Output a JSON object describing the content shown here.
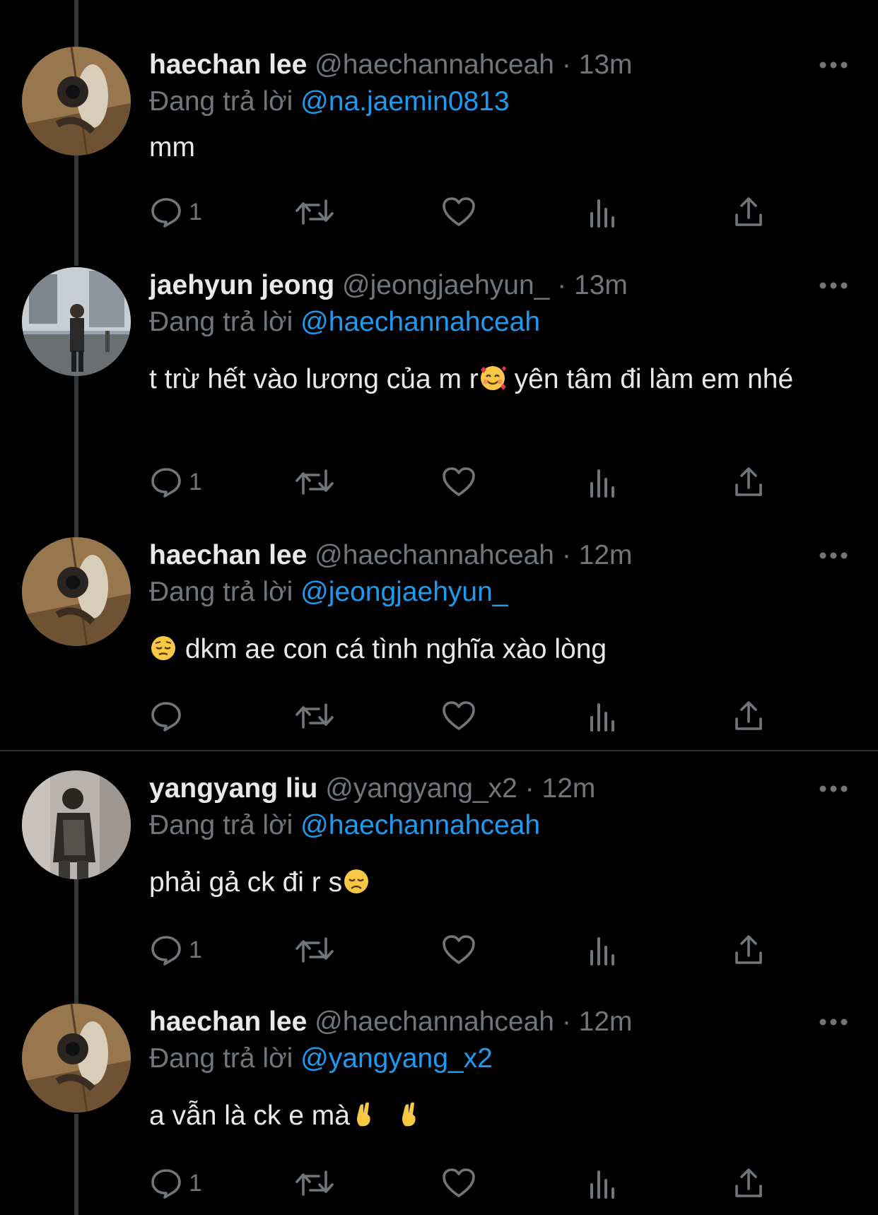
{
  "reply_prefix": "Đang trả lời",
  "colors": {
    "background": "#000000",
    "text": "#e7e9ea",
    "muted": "#71767b",
    "mention": "#1d9bf0",
    "thread_line": "#333639"
  },
  "tweets": [
    {
      "name": "haechan lee",
      "handle": "@haechannahceah",
      "time": "· 13m",
      "reply_to": "@na.jaemin0813",
      "text": "mm",
      "reply_count": "1"
    },
    {
      "name": "jaehyun jeong",
      "handle": "@jeongjaehyun_",
      "time": "· 13m",
      "reply_to": "@haechannahceah",
      "text_a": "t trừ hết vào lương của m r",
      "text_b": " yên tâm đi làm em nhé",
      "emoji": "smiling-face-with-hearts",
      "reply_count": "1"
    },
    {
      "name": "haechan lee",
      "handle": "@haechannahceah",
      "time": "· 12m",
      "reply_to": "@jeongjaehyun_",
      "text": " dkm ae con cá tình nghĩa xào lòng",
      "emoji": "pensive-face",
      "reply_count": ""
    },
    {
      "name": "yangyang liu",
      "handle": "@yangyang_x2",
      "time": "· 12m",
      "reply_to": "@haechannahceah",
      "text": "phải gả ck đi r s",
      "emoji": "disappointed-face",
      "reply_count": "1"
    },
    {
      "name": "haechan lee",
      "handle": "@haechannahceah",
      "time": "· 12m",
      "reply_to": "@yangyang_x2",
      "text": "a vẫn là ck e mà",
      "emoji": "crossed-fingers",
      "reply_count": "1"
    }
  ]
}
